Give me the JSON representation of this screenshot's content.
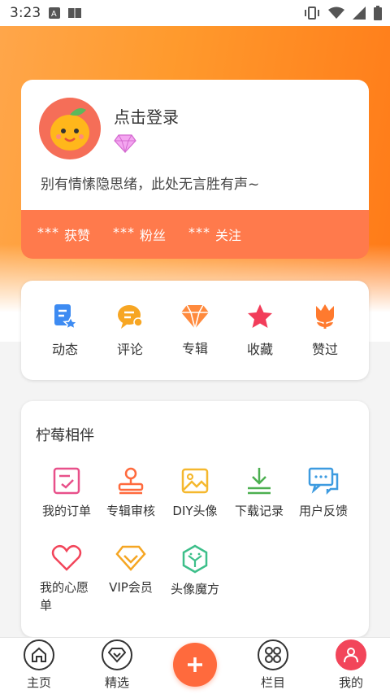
{
  "status_bar": {
    "time": "3:23"
  },
  "profile": {
    "login_prompt": "点击登录",
    "signature": "别有情愫隐思绪，此处无言胜有声~",
    "stats": [
      {
        "value": "***",
        "label": "获赞"
      },
      {
        "value": "***",
        "label": "粉丝"
      },
      {
        "value": "***",
        "label": "关注"
      }
    ]
  },
  "actions": [
    {
      "label": "动态",
      "icon": "document-star-icon"
    },
    {
      "label": "评论",
      "icon": "comment-icon"
    },
    {
      "label": "专辑",
      "icon": "diamond-icon"
    },
    {
      "label": "收藏",
      "icon": "star-icon"
    },
    {
      "label": "赞过",
      "icon": "tulip-icon"
    }
  ],
  "services": {
    "title": "柠莓相伴",
    "items": [
      {
        "label": "我的订单",
        "icon": "order-icon"
      },
      {
        "label": "专辑审核",
        "icon": "stamp-icon"
      },
      {
        "label": "DIY头像",
        "icon": "image-icon"
      },
      {
        "label": "下载记录",
        "icon": "download-icon"
      },
      {
        "label": "用户反馈",
        "icon": "feedback-icon"
      },
      {
        "label": "我的心愿单",
        "icon": "heart-icon"
      },
      {
        "label": "VIP会员",
        "icon": "vip-diamond-icon"
      },
      {
        "label": "头像魔方",
        "icon": "cube-icon"
      }
    ]
  },
  "bottom_nav": [
    {
      "label": "主页",
      "icon": "home-icon"
    },
    {
      "label": "精选",
      "icon": "diamond-outline-icon"
    },
    {
      "label": "栏目",
      "icon": "grid-icon"
    },
    {
      "label": "我的",
      "icon": "user-icon",
      "active": true
    }
  ],
  "colors": {
    "accent": "#ff6a3d",
    "hero_start": "#ffa64a",
    "hero_end": "#ff7a18",
    "stats_bar": "#ff7a4c"
  }
}
